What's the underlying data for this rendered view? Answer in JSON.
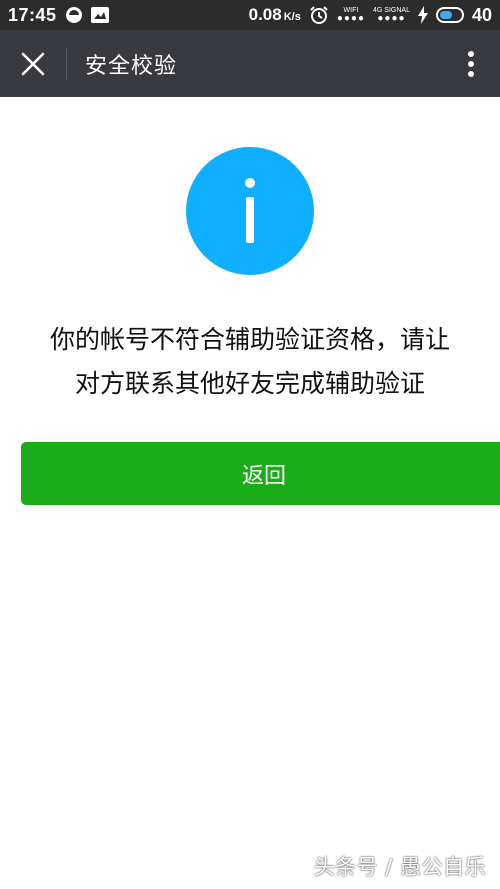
{
  "status_bar": {
    "time": "17:45",
    "net_speed": "0.08",
    "net_speed_unit": "K/s",
    "wifi_label": "WIFI",
    "signal_label": "4G SIGNAL",
    "battery": "40"
  },
  "header": {
    "title": "安全校验"
  },
  "main": {
    "message_line1": "你的帐号不符合辅助验证资格，请让",
    "message_line2": "对方联系其他好友完成辅助验证",
    "return_button": "返回"
  },
  "watermark": "头条号 / 愚公自乐",
  "colors": {
    "status_bg": "#2c2c2c",
    "header_bg": "#393a3f",
    "info_icon": "#10aeff",
    "primary_button": "#1aad19"
  },
  "icons": {
    "close": "close-icon",
    "more": "more-vertical-icon",
    "info": "info-icon"
  }
}
